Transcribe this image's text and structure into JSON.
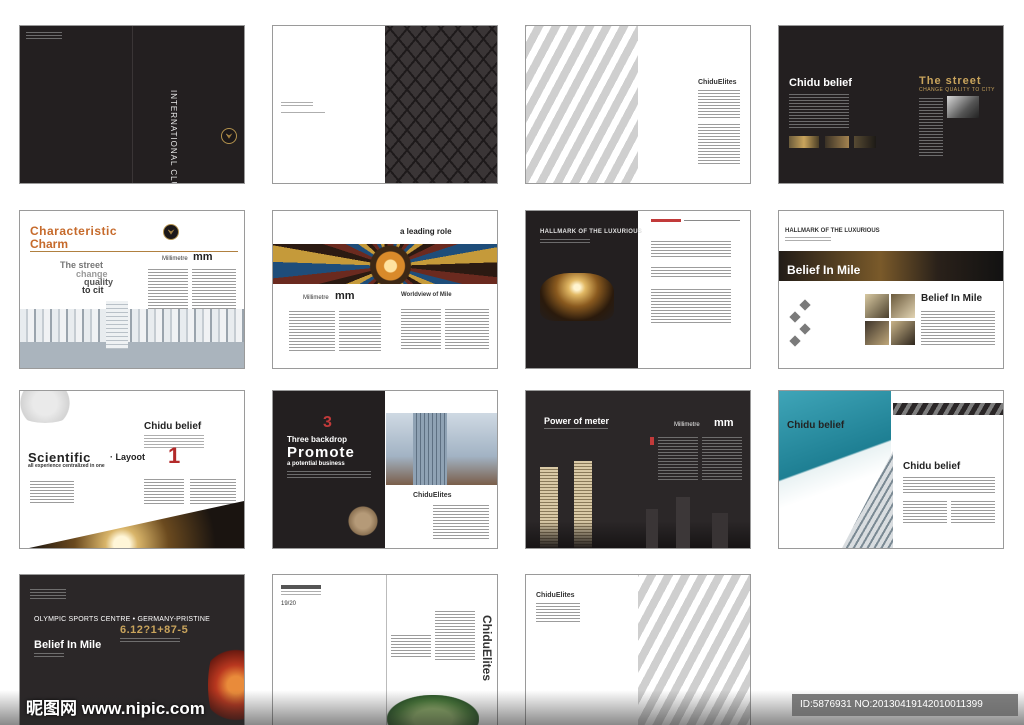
{
  "spreads": {
    "s1": {
      "vertical_title": "INTERNATIONAL CLUB"
    },
    "s3": {
      "brand": "ChiduElites"
    },
    "s4": {
      "title_left": "Chidu belief",
      "title_right": "The street",
      "sub_right": "CHANGE QUALITY TO CITY"
    },
    "s5": {
      "title_line1": "Characteristic",
      "title_line2": "Charm",
      "tag_line1": "The street",
      "tag_line2": "change",
      "tag_line3": "quality",
      "tag_line4": "to cit",
      "mm_label": "Millimetre",
      "mm_mark": "mm"
    },
    "s6": {
      "heading": "a leading role",
      "mm_label": "Millimetre",
      "mm_mark": "mm",
      "worldview": "Worldview of Mile"
    },
    "s7": {
      "title": "HALLMARK OF THE LUXURIOUS"
    },
    "s8": {
      "title": "HALLMARK OF THE LUXURIOUS",
      "banner": "Belief In Mile",
      "side_heading": "Belief In Mile"
    },
    "s9": {
      "title": "Chidu belief",
      "main_line1": "Scientific",
      "main_line1b": "· Layoot",
      "main_line2": "all experience centralized in one",
      "num": "1"
    },
    "s10": {
      "num": "3",
      "line1": "Three backdrop",
      "line2": "Promote",
      "line3": "a potential business",
      "brand": "ChiduElites"
    },
    "s11": {
      "title": "Power of meter",
      "mm_label": "Millimetre",
      "mm_mark": "mm"
    },
    "s12": {
      "title_top": "Chidu belief",
      "title_mid": "Chidu belief"
    },
    "s13": {
      "line1": "OLYMPIC SPORTS CENTRE • GERMANY-PRISTINE",
      "numbers": "6.12?1+87-5",
      "heading": "Belief In Mile"
    },
    "s14": {
      "page_num": "19/20",
      "vertical_brand": "ChiduElites"
    },
    "s15": {
      "brand": "ChiduElites"
    }
  },
  "footer": {
    "watermark_left": "昵图网 www.nipic.com",
    "id_text": "ID:5876931 NO:20130419142010011399"
  }
}
